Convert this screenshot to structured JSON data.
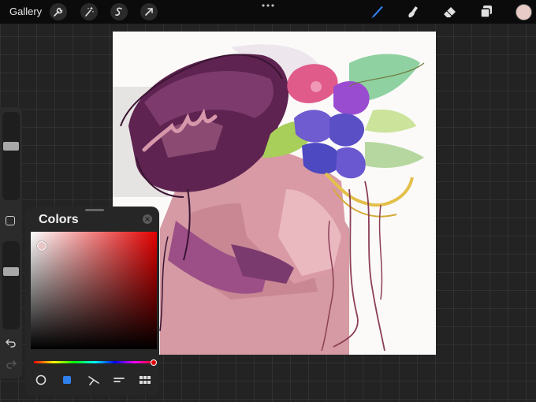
{
  "topbar": {
    "gallery_label": "Gallery",
    "left_tools": [
      "wrench-icon",
      "magic-wand-icon",
      "selection-icon",
      "transform-arrow-icon"
    ],
    "more_dots": "•••",
    "right_tools": [
      "brush-icon",
      "smudge-icon",
      "eraser-icon",
      "layers-icon"
    ],
    "current_color": "#e8cbc6",
    "active_tool_color": "#2f80ed"
  },
  "sidebar": {
    "size_slider_level": 0.62,
    "opacity_slider_level": 0.67,
    "icons": [
      "modify-square-icon",
      "undo-icon",
      "redo-icon"
    ]
  },
  "colors_panel": {
    "title": "Colors",
    "close_icon": "close-icon",
    "hue": "#e30000",
    "selected_color": "#e8c6c6",
    "modes": [
      "disc-mode-icon",
      "classic-mode-icon",
      "harmony-mode-icon",
      "value-mode-icon",
      "palettes-icon"
    ],
    "active_mode": "classic-mode-icon",
    "active_mode_color": "#2f80ed"
  },
  "canvas": {
    "background": "#fbfaf9",
    "artwork": "painting"
  }
}
